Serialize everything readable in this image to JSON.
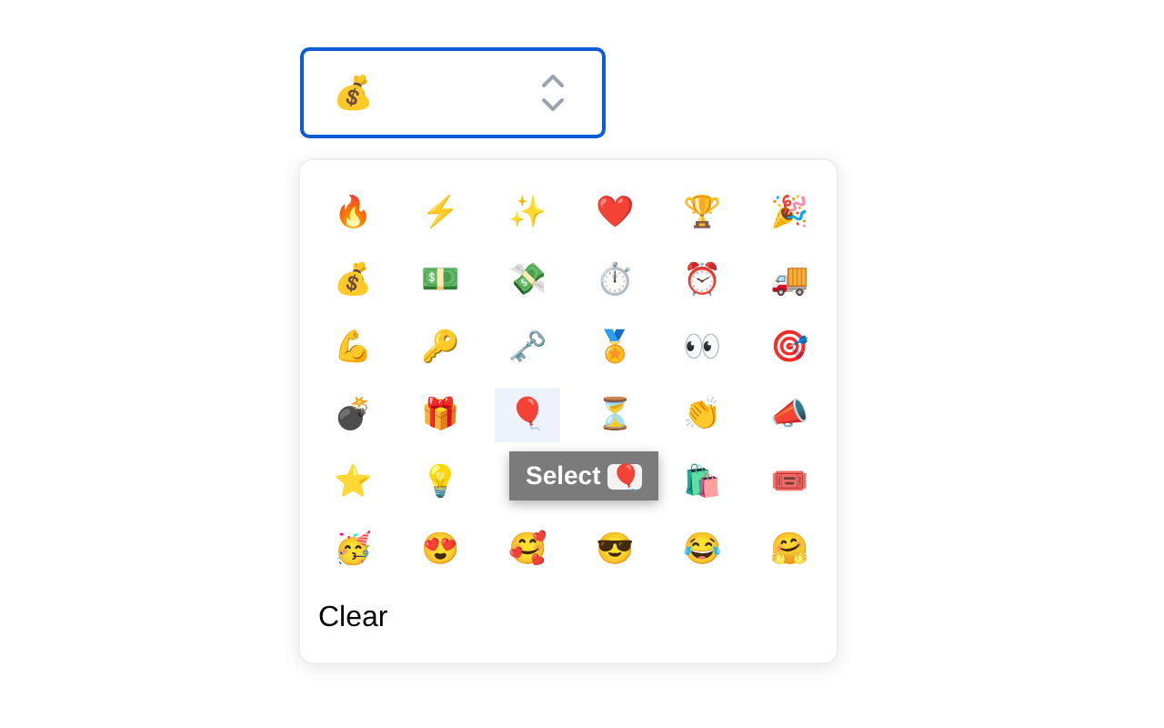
{
  "select": {
    "value": "💰"
  },
  "picker": {
    "rows": [
      [
        {
          "emoji": "🔥",
          "hovered": false
        },
        {
          "emoji": "⚡",
          "hovered": false
        },
        {
          "emoji": "✨",
          "hovered": false
        },
        {
          "emoji": "❤️",
          "hovered": false
        },
        {
          "emoji": "🏆",
          "hovered": false
        },
        {
          "emoji": "🎉",
          "hovered": false
        }
      ],
      [
        {
          "emoji": "💰",
          "hovered": false
        },
        {
          "emoji": "💵",
          "hovered": false
        },
        {
          "emoji": "💸",
          "hovered": false
        },
        {
          "emoji": "⏱️",
          "hovered": false
        },
        {
          "emoji": "⏰",
          "hovered": false
        },
        {
          "emoji": "🚚",
          "hovered": false
        }
      ],
      [
        {
          "emoji": "💪",
          "hovered": false
        },
        {
          "emoji": "🔑",
          "hovered": false
        },
        {
          "emoji": "🗝️",
          "hovered": false
        },
        {
          "emoji": "🏅",
          "hovered": false
        },
        {
          "emoji": "👀",
          "hovered": false
        },
        {
          "emoji": "🎯",
          "hovered": false
        }
      ],
      [
        {
          "emoji": "💣",
          "hovered": false
        },
        {
          "emoji": "🎁",
          "hovered": false
        },
        {
          "emoji": "🎈",
          "hovered": true
        },
        {
          "emoji": "⏳",
          "hovered": false
        },
        {
          "emoji": "👏",
          "hovered": false
        },
        {
          "emoji": "📣",
          "hovered": false
        }
      ],
      [
        {
          "emoji": "⭐",
          "hovered": false
        },
        {
          "emoji": "💡",
          "hovered": false
        },
        null,
        null,
        {
          "emoji": "🛍️",
          "hovered": false
        },
        {
          "emoji": "🎟️",
          "hovered": false
        }
      ],
      [
        {
          "emoji": "🥳",
          "hovered": false
        },
        {
          "emoji": "😍",
          "hovered": false
        },
        {
          "emoji": "🥰",
          "hovered": false
        },
        {
          "emoji": "😎",
          "hovered": false
        },
        {
          "emoji": "😂",
          "hovered": false
        },
        {
          "emoji": "🤗",
          "hovered": false
        }
      ]
    ],
    "clear": "Clear"
  },
  "tooltip": {
    "label": "Select",
    "emoji": "🎈"
  }
}
